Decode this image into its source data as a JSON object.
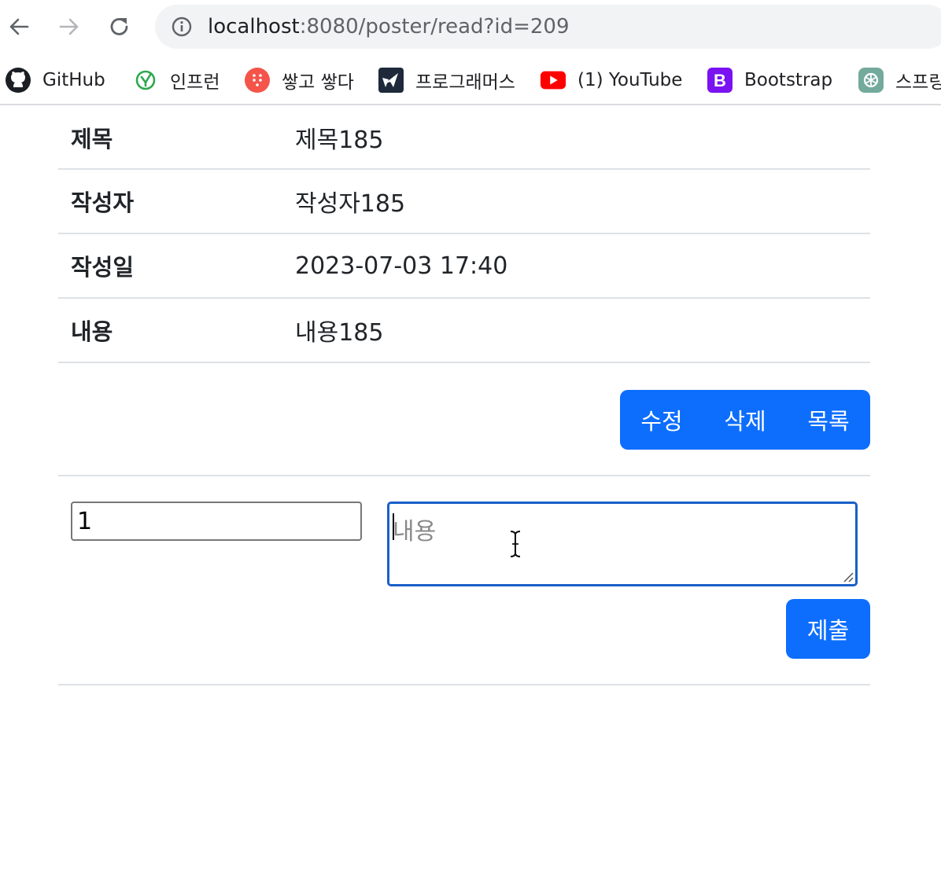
{
  "browser": {
    "url_host": "localhost",
    "url_rest": ":8080/poster/read?id=209",
    "bookmarks": [
      {
        "label": "GitHub",
        "icon": "github-icon"
      },
      {
        "label": "인프런",
        "icon": "inflearn-icon"
      },
      {
        "label": "쌓고 쌓다",
        "icon": "dots-icon"
      },
      {
        "label": "프로그래머스",
        "icon": "programmers-icon"
      },
      {
        "label": "(1) YouTube",
        "icon": "youtube-icon"
      },
      {
        "label": "Bootstrap",
        "icon": "bootstrap-icon"
      },
      {
        "label": "스프링",
        "icon": "openai-icon"
      }
    ]
  },
  "post": {
    "rows": [
      {
        "header": "제목",
        "value": "제목185"
      },
      {
        "header": "작성자",
        "value": "작성자185"
      },
      {
        "header": "작성일",
        "value": "2023-07-03 17:40"
      },
      {
        "header": "내용",
        "value": "내용185"
      }
    ]
  },
  "actions": {
    "edit_label": "수정",
    "delete_label": "삭제",
    "list_label": "목록"
  },
  "comment_form": {
    "number_value": "1",
    "content_placeholder": "내용",
    "submit_label": "제출"
  },
  "colors": {
    "primary": "#0d6efd",
    "focus_border": "#1a5fc8",
    "divider": "#dee2e6"
  }
}
